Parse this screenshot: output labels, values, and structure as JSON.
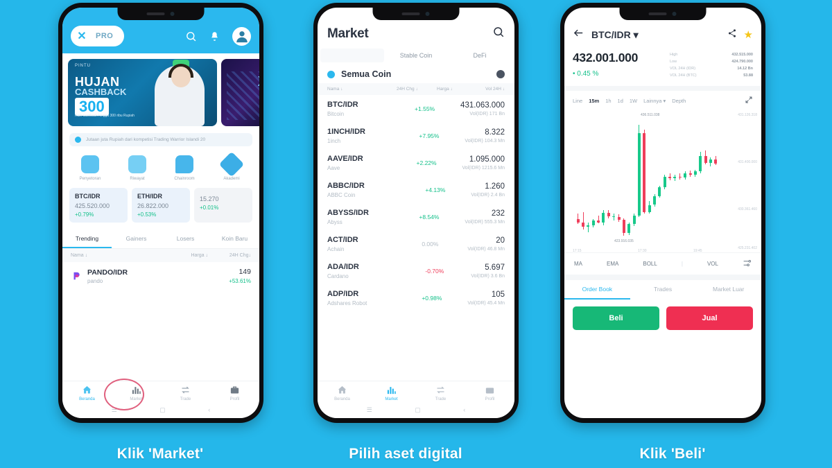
{
  "page": {
    "background_color": "#25b7ea",
    "captions": [
      {
        "id": "cap1",
        "text": "Klik 'Market'"
      },
      {
        "id": "cap2",
        "text": "Pilih aset digital"
      },
      {
        "id": "cap3",
        "text": "Klik 'Beli'"
      }
    ]
  },
  "phone1": {
    "header": {
      "logo": "x-logo",
      "pro_label": "PRO",
      "search_icon": "search-icon",
      "bell_icon": "bell-icon",
      "avatar_icon": "avatar-icon"
    },
    "banner": {
      "brand": "PINTU",
      "line1": "HUJAN",
      "line2": "CASHBACK",
      "amount": "300",
      "sub": "Raih cashback hingga 300 ribu Rupiah"
    },
    "notice": {
      "text": "Jutaan juta Rupiah dari kompetisi Trading Warrior Islandi 20"
    },
    "quick_actions": [
      {
        "label": "Penyetoran",
        "icon": "deposit-icon"
      },
      {
        "label": "Riwayat",
        "icon": "history-icon"
      },
      {
        "label": "Chainroom",
        "icon": "chainroom-icon"
      },
      {
        "label": "Akademi",
        "icon": "academy-icon"
      }
    ],
    "tickers": [
      {
        "symbol": "BTC/IDR",
        "price": "425.520.000",
        "change": "+0.79%"
      },
      {
        "symbol": "ETH/IDR",
        "price": "26.822.000",
        "change": "+0.53%"
      },
      {
        "symbol": "",
        "price": "15.270",
        "change": "+0.01%"
      }
    ],
    "list_tabs": [
      {
        "label": "Trending",
        "active": true
      },
      {
        "label": "Gainers",
        "active": false
      },
      {
        "label": "Losers",
        "active": false
      },
      {
        "label": "Koin Baru",
        "active": false
      }
    ],
    "list_headers": {
      "name": "Nama ↓",
      "price": "Harga ↓",
      "change": "24H Chg↓"
    },
    "rows": [
      {
        "symbol": "PANDO/IDR",
        "name": "pando",
        "price": "149",
        "change": "+53.61%"
      }
    ],
    "bottom_nav": [
      {
        "label": "Beranda",
        "icon": "home-icon",
        "active": true
      },
      {
        "label": "Market",
        "icon": "market-bars-icon",
        "active": false,
        "highlighted": true
      },
      {
        "label": "Trade",
        "icon": "trade-icon",
        "active": false
      },
      {
        "label": "Profil",
        "icon": "profile-icon",
        "active": false
      }
    ],
    "gesture_bar": [
      "menu-icon",
      "home-square-icon",
      "back-icon"
    ]
  },
  "phone2": {
    "title": "Market",
    "search_icon": "search-icon",
    "filter_tabs": [
      {
        "label": "",
        "active": true
      },
      {
        "label": "Stable Coin",
        "active": false
      },
      {
        "label": "DeFi",
        "active": false
      }
    ],
    "group": {
      "label": "Semua Coin",
      "settings_icon": "gear-icon"
    },
    "headers": {
      "name": "Nama ↓",
      "chg": "24H Chg ↓",
      "price": "Harga ↓",
      "vol": "Vol 24H ↓"
    },
    "coins": [
      {
        "pair": "BTC/IDR",
        "name": "Bitcoin",
        "change": "+1.55%",
        "direction": "up",
        "price": "431.063.000",
        "volume": "Vol(IDR) 171 Bn"
      },
      {
        "pair": "1INCH/IDR",
        "name": "1inch",
        "change": "+7.95%",
        "direction": "up",
        "price": "8.322",
        "volume": "Vol(IDR) 104.3 Mn"
      },
      {
        "pair": "AAVE/IDR",
        "name": "Aave",
        "change": "+2.22%",
        "direction": "up",
        "price": "1.095.000",
        "volume": "Vol(IDR) 1215.6 Mn"
      },
      {
        "pair": "ABBC/IDR",
        "name": "ABBC Coin",
        "change": "+4.13%",
        "direction": "up",
        "price": "1.260",
        "volume": "Vol(IDR) 2.4 Bn"
      },
      {
        "pair": "ABYSS/IDR",
        "name": "Abyss",
        "change": "+8.54%",
        "direction": "up",
        "price": "232",
        "volume": "Vol(IDR) 555.3 Mn"
      },
      {
        "pair": "ACT/IDR",
        "name": "Achain",
        "change": "0.00%",
        "direction": "flat",
        "price": "20",
        "volume": "Vol(IDR) 46.8 Mn"
      },
      {
        "pair": "ADA/IDR",
        "name": "Cardano",
        "change": "-0.70%",
        "direction": "down",
        "price": "5.697",
        "volume": "Vol(IDR) 3.6 Bn"
      },
      {
        "pair": "ADP/IDR",
        "name": "Adshares Robot",
        "change": "+0.98%",
        "direction": "up",
        "price": "105",
        "volume": "Vol(IDR) 45.4 Mn"
      }
    ],
    "bottom_nav": [
      {
        "label": "Beranda",
        "icon": "home-icon",
        "active": false
      },
      {
        "label": "Market",
        "icon": "market-bars-icon",
        "active": true
      },
      {
        "label": "Trade",
        "icon": "trade-icon",
        "active": false
      },
      {
        "label": "Profil",
        "icon": "profile-icon",
        "active": false
      }
    ]
  },
  "phone3": {
    "back_icon": "arrow-left-icon",
    "pair": "BTC/IDR ▾",
    "share_icon": "share-icon",
    "star_icon": "star-icon",
    "price": "432.001.000",
    "change": "0.45 %",
    "stats": [
      {
        "label": "High",
        "value": "432.515.000"
      },
      {
        "label": "Low",
        "value": "424.790.000"
      },
      {
        "label": "VOL 24H (IDR)",
        "value": "14.12 Bn"
      },
      {
        "label": "VOL 24H (BTC)",
        "value": "53.88"
      }
    ],
    "timeframes": [
      {
        "label": "Line",
        "active": false
      },
      {
        "label": "15m",
        "active": true
      },
      {
        "label": "1h",
        "active": false
      },
      {
        "label": "1d",
        "active": false
      },
      {
        "label": "1W",
        "active": false
      },
      {
        "label": "Lainnya ▾",
        "active": false
      },
      {
        "label": "Depth",
        "active": false
      }
    ],
    "expand_icon": "expand-icon",
    "chart_annotations": {
      "high_label": "436.511.038",
      "low_label": "423.916.035"
    },
    "indicators": [
      {
        "label": "MA"
      },
      {
        "label": "EMA"
      },
      {
        "label": "BOLL"
      },
      {
        "label": "|"
      },
      {
        "label": "VOL"
      }
    ],
    "indicator_settings_icon": "sliders-icon",
    "order_tabs": [
      {
        "label": "Order Book",
        "active": true
      },
      {
        "label": "Trades",
        "active": false
      },
      {
        "label": "Market Luar",
        "active": false
      }
    ],
    "buy_label": "Beli",
    "sell_label": "Jual",
    "buy_color": "#17b877",
    "sell_color": "#ef2f52"
  },
  "chart_data": {
    "type": "candlestick",
    "title": "BTC/IDR 15m",
    "ylabel": "",
    "xlabel": "",
    "ylim": [
      419000000,
      441000000
    ],
    "y_ticks": [
      "431.126.318",
      "431.400.000",
      "430.361.460",
      "425.231.402"
    ],
    "x_ticks": [
      "17:15",
      "17:30",
      "19:45"
    ],
    "annotations": [
      {
        "text": "436.511.038",
        "type": "high-marker"
      },
      {
        "text": "423.916.035",
        "type": "low-marker"
      }
    ],
    "candles": [
      {
        "o": 425.8,
        "h": 426.4,
        "l": 425.2,
        "c": 425.4,
        "dir": "down"
      },
      {
        "o": 425.4,
        "h": 426.6,
        "l": 424.6,
        "c": 424.9,
        "dir": "down"
      },
      {
        "o": 424.9,
        "h": 425.4,
        "l": 424.3,
        "c": 425.1,
        "dir": "up"
      },
      {
        "o": 425.1,
        "h": 425.8,
        "l": 424.8,
        "c": 425.6,
        "dir": "up"
      },
      {
        "o": 425.6,
        "h": 426.2,
        "l": 425.3,
        "c": 425.4,
        "dir": "down"
      },
      {
        "o": 425.4,
        "h": 426.8,
        "l": 425.1,
        "c": 426.5,
        "dir": "up"
      },
      {
        "o": 426.5,
        "h": 426.8,
        "l": 425.9,
        "c": 426.1,
        "dir": "down"
      },
      {
        "o": 426.1,
        "h": 426.4,
        "l": 425.6,
        "c": 426.0,
        "dir": "up"
      },
      {
        "o": 426.0,
        "h": 426.3,
        "l": 425.5,
        "c": 425.7,
        "dir": "down"
      },
      {
        "o": 425.7,
        "h": 425.9,
        "l": 423.9,
        "c": 424.2,
        "dir": "down"
      },
      {
        "o": 424.2,
        "h": 425.4,
        "l": 424.0,
        "c": 425.2,
        "dir": "up"
      },
      {
        "o": 425.2,
        "h": 426.4,
        "l": 425.0,
        "c": 426.2,
        "dir": "up"
      },
      {
        "o": 426.2,
        "h": 436.5,
        "l": 426.0,
        "c": 435.6,
        "dir": "up"
      },
      {
        "o": 435.6,
        "h": 436.0,
        "l": 426.4,
        "c": 426.6,
        "dir": "down"
      },
      {
        "o": 426.6,
        "h": 427.8,
        "l": 426.4,
        "c": 427.4,
        "dir": "up"
      },
      {
        "o": 427.4,
        "h": 428.6,
        "l": 427.2,
        "c": 428.4,
        "dir": "up"
      },
      {
        "o": 428.4,
        "h": 429.6,
        "l": 428.2,
        "c": 429.4,
        "dir": "up"
      },
      {
        "o": 429.4,
        "h": 430.8,
        "l": 429.2,
        "c": 430.6,
        "dir": "up"
      },
      {
        "o": 430.6,
        "h": 431.0,
        "l": 430.2,
        "c": 430.4,
        "dir": "down"
      },
      {
        "o": 430.4,
        "h": 430.8,
        "l": 430.1,
        "c": 430.6,
        "dir": "up"
      },
      {
        "o": 430.6,
        "h": 431.0,
        "l": 430.3,
        "c": 430.5,
        "dir": "down"
      },
      {
        "o": 430.5,
        "h": 431.2,
        "l": 430.3,
        "c": 431.0,
        "dir": "up"
      },
      {
        "o": 431.0,
        "h": 431.3,
        "l": 430.6,
        "c": 430.8,
        "dir": "down"
      },
      {
        "o": 430.8,
        "h": 431.4,
        "l": 430.6,
        "c": 431.2,
        "dir": "up"
      },
      {
        "o": 431.2,
        "h": 433.4,
        "l": 431.0,
        "c": 433.0,
        "dir": "up"
      },
      {
        "o": 433.0,
        "h": 433.6,
        "l": 432.0,
        "c": 432.2,
        "dir": "down"
      },
      {
        "o": 432.2,
        "h": 432.8,
        "l": 431.8,
        "c": 432.6,
        "dir": "up"
      },
      {
        "o": 432.6,
        "h": 433.0,
        "l": 431.9,
        "c": 432.1,
        "dir": "down"
      }
    ]
  }
}
